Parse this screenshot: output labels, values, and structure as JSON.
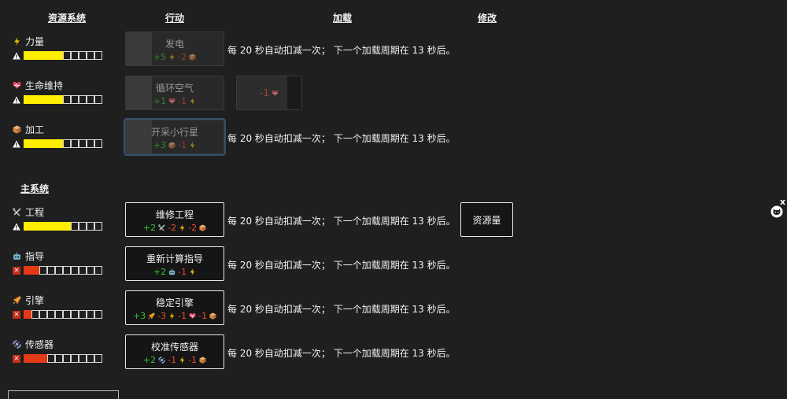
{
  "headers": {
    "resource": "资源系统",
    "action": "行动",
    "load": "加载",
    "modify": "修改"
  },
  "main_section_title": "主系统",
  "resources": [
    {
      "name": "力量",
      "icon": "lightning-icon",
      "status": "warning",
      "filled": 5,
      "total": 10,
      "color": "#ffee00"
    },
    {
      "name": "生命维持",
      "icon": "heart-icon",
      "status": "warning",
      "filled": 5,
      "total": 10,
      "color": "#ffee00"
    },
    {
      "name": "加工",
      "icon": "cube-icon",
      "status": "warning",
      "filled": 5,
      "total": 10,
      "color": "#ffee00"
    }
  ],
  "main_systems": [
    {
      "name": "工程",
      "icon": "tools-icon",
      "status": "warning",
      "filled": 6,
      "total": 10,
      "color": "#ffee00"
    },
    {
      "name": "指导",
      "icon": "robot-icon",
      "status": "error",
      "filled": 2,
      "total": 10,
      "color": "#e33b16"
    },
    {
      "name": "引擎",
      "icon": "rocket-icon",
      "status": "error",
      "filled": 1,
      "total": 10,
      "color": "#e33b16"
    },
    {
      "name": "传感器",
      "icon": "satellite-icon",
      "status": "error",
      "filled": 3,
      "total": 10,
      "color": "#e33b16"
    }
  ],
  "actions": [
    {
      "label": "发电",
      "cost": [
        "+5",
        "-2"
      ]
    },
    {
      "label": "循环空气",
      "cost": [
        "+1",
        "-1"
      ]
    },
    {
      "label": "开采小行星",
      "cost": [
        "+3",
        "-1"
      ]
    },
    {
      "label": "维修工程",
      "cost": [
        "+2",
        "-2",
        "-2"
      ]
    },
    {
      "label": "重新计算指导",
      "cost": [
        "+2",
        "-1"
      ]
    },
    {
      "label": "稳定引擎",
      "cost": [
        "+3",
        "-3",
        "-1",
        "-1"
      ]
    },
    {
      "label": "校准传感器",
      "cost": [
        "+2",
        "-1",
        "-1"
      ]
    }
  ],
  "extra_action": {
    "cost": "-1"
  },
  "load_text": "每 20 秒自动扣减一次； 下一个加载周期在 13 秒后。",
  "modify_button": "资源量",
  "close_label": "x",
  "colors": {
    "positive": "#3ec03e",
    "negative": "#ee4d2d",
    "warning": "#ffee00",
    "error": "#e33b16"
  }
}
